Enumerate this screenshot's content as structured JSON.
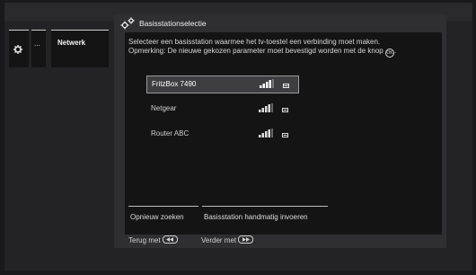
{
  "breadcrumb": {
    "items": [
      {
        "icon": "gear-icon"
      },
      {
        "label": "..."
      },
      {
        "label": "Netwerk"
      }
    ]
  },
  "dialog": {
    "title": "Basisstationselectie",
    "title_icon": "settings-icon",
    "message_line1": "Selecteer een basisstation waarmee het tv-toestel een verbinding moet maken.",
    "message_line2": "Opmerking: De nieuwe gekozen parameter moet bevestigd worden met de knop",
    "message_button_symbol": "OK",
    "stations": [
      {
        "name": "FritzBox 7490",
        "selected": true,
        "signal_bars": 4,
        "secured": true
      },
      {
        "name": "Netgear",
        "selected": false,
        "signal_bars": 4,
        "secured": true
      },
      {
        "name": "Router ABC",
        "selected": false,
        "signal_bars": 4,
        "secured": true
      }
    ],
    "actions": [
      {
        "label": "Opnieuw zoeken"
      },
      {
        "label": "Basisstation handmatig invoeren"
      }
    ]
  },
  "footer": {
    "back_label": "Terug met",
    "next_label": "Verder met"
  },
  "colors": {
    "background": "#19191b",
    "dialog": "#2f2f31",
    "panel": "#141415",
    "selection": "#3e3e40",
    "text": "#d8d8d8"
  }
}
